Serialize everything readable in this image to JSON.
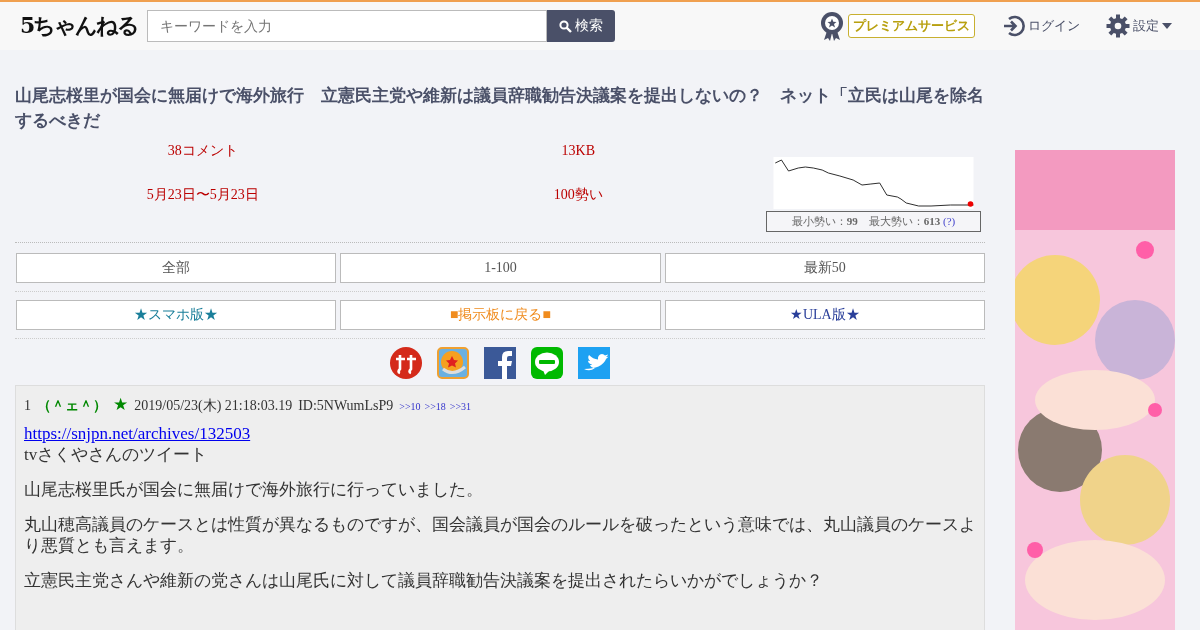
{
  "header": {
    "logo": "5ちゃんねる",
    "search_placeholder": "キーワードを入力",
    "search_button": "検索",
    "premium": "プレミアムサービス",
    "login": "ログイン",
    "settings": "設定"
  },
  "title": "山尾志桜里が国会に無届けで海外旅行　立憲民主党や維新は議員辞職勧告決議案を提出しないの？　ネット「立民は山尾を除名するべきだ",
  "stats": {
    "comments": "38コメント",
    "size": "13KB",
    "dates": "5月23日〜5月23日",
    "momentum": "100勢い",
    "chart_info": "最小勢い：**99**　最大勢い：**613**",
    "chart_help": "(?)"
  },
  "nav_buttons": [
    {
      "label": "全部"
    },
    {
      "label": "1-100"
    },
    {
      "label": "最新50"
    }
  ],
  "link_buttons": [
    {
      "label": "★スマホ版★",
      "color": "#1a7f9a"
    },
    {
      "label": "■掲示板に戻る■",
      "color": "#f08c1e"
    },
    {
      "label": "★ULA版★",
      "color": "#2a3f9a"
    }
  ],
  "share_icons": [
    {
      "kind": "sus"
    },
    {
      "kind": "ball"
    },
    {
      "kind": "facebook"
    },
    {
      "kind": "line"
    },
    {
      "kind": "twitter"
    }
  ],
  "post": {
    "number": "1",
    "name": "（＾ェ＾）",
    "mark": "★",
    "date": "2019/05/23(木) 21:18:03.19",
    "id": "ID:5NWumLsP9",
    "replies": [
      ">>10",
      ">>18",
      ">>31"
    ],
    "link": "https://snjpn.net/archives/132503",
    "paragraphs": [
      [
        "tvさくやさんのツイート"
      ],
      [
        "山尾志桜里氏が国会に無届けで海外旅行に行っていました。"
      ],
      [
        "丸山穂高議員のケースとは性質が異なるものですが、国会議員が国会のルールを破ったという意味では、丸山議員のケースより悪質とも言えます。"
      ],
      [
        "立憲民主党さんや維新の党さんは山尾氏に対して議員辞職勧告決議案を提出されたらいかがでしょうか？"
      ]
    ]
  }
}
